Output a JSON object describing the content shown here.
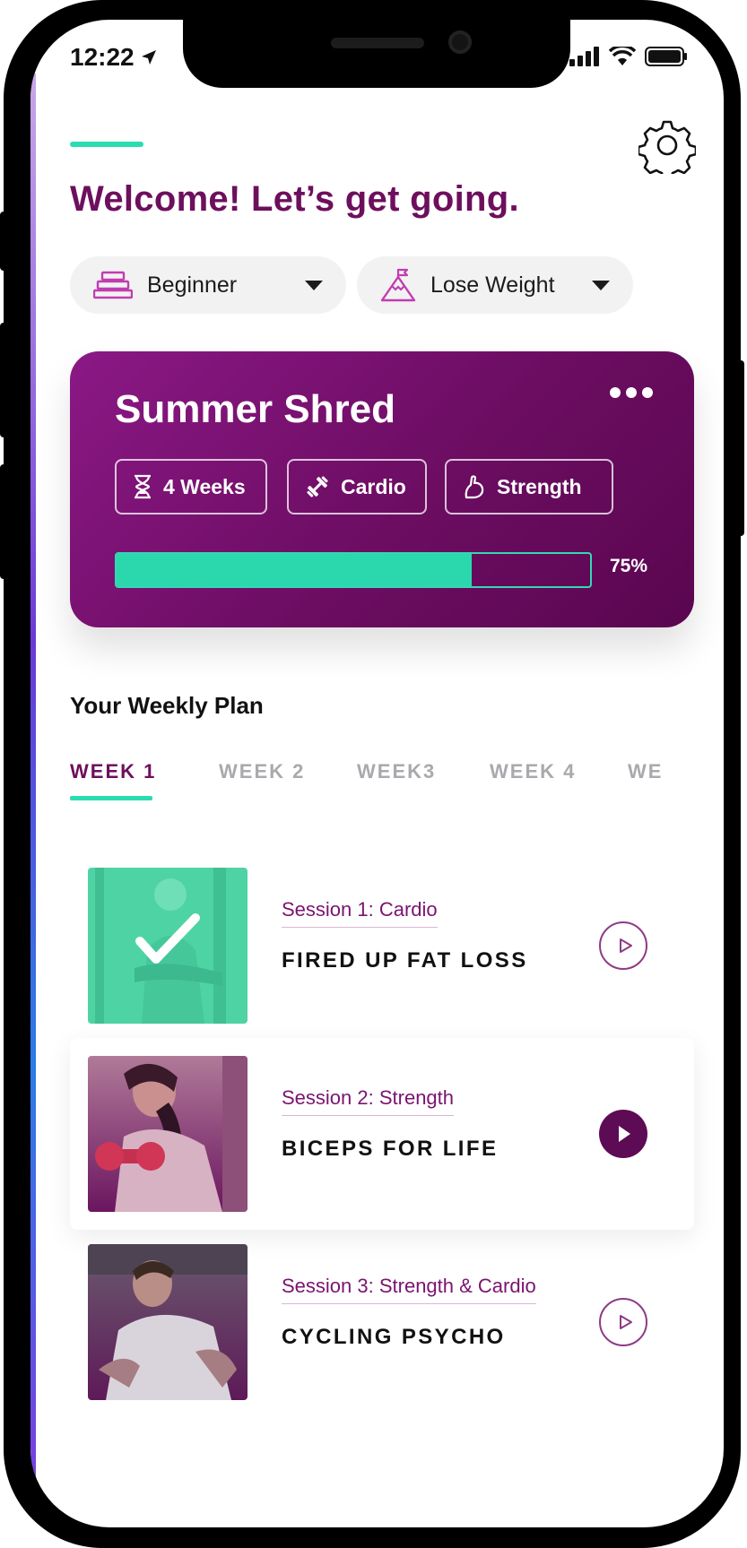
{
  "status_bar": {
    "time": "12:22"
  },
  "header": {
    "welcome": "Welcome! Let’s get going."
  },
  "filters": {
    "level": {
      "label": "Beginner"
    },
    "goal": {
      "label": "Lose Weight"
    }
  },
  "plan": {
    "title": "Summer Shred",
    "tags": [
      {
        "label": "4 Weeks",
        "icon": "hourglass-icon"
      },
      {
        "label": "Cardio",
        "icon": "dumbbell-icon"
      },
      {
        "label": "Strength",
        "icon": "flexed-arm-icon"
      }
    ],
    "progress_percent": 75,
    "progress_label": "75%"
  },
  "weekly": {
    "title": "Your Weekly Plan",
    "tabs": [
      "WEEK 1",
      "WEEK 2",
      "WEEK3",
      "WEEK 4",
      "WE"
    ],
    "active_tab": 0
  },
  "sessions": [
    {
      "subtitle": "Session 1: Cardio",
      "name": "FIRED UP FAT LOSS",
      "completed": true,
      "play_style": "outline"
    },
    {
      "subtitle": "Session 2: Strength",
      "name": "BICEPS FOR LIFE",
      "completed": false,
      "play_style": "filled"
    },
    {
      "subtitle": "Session 3: Strength & Cardio",
      "name": "CYCLING PSYCHO",
      "completed": false,
      "play_style": "outline"
    }
  ],
  "colors": {
    "brand_purple": "#6d0f5d",
    "accent_teal": "#2bdcb1",
    "card_gradient_start": "#8b1886",
    "card_gradient_end": "#5a0650"
  }
}
